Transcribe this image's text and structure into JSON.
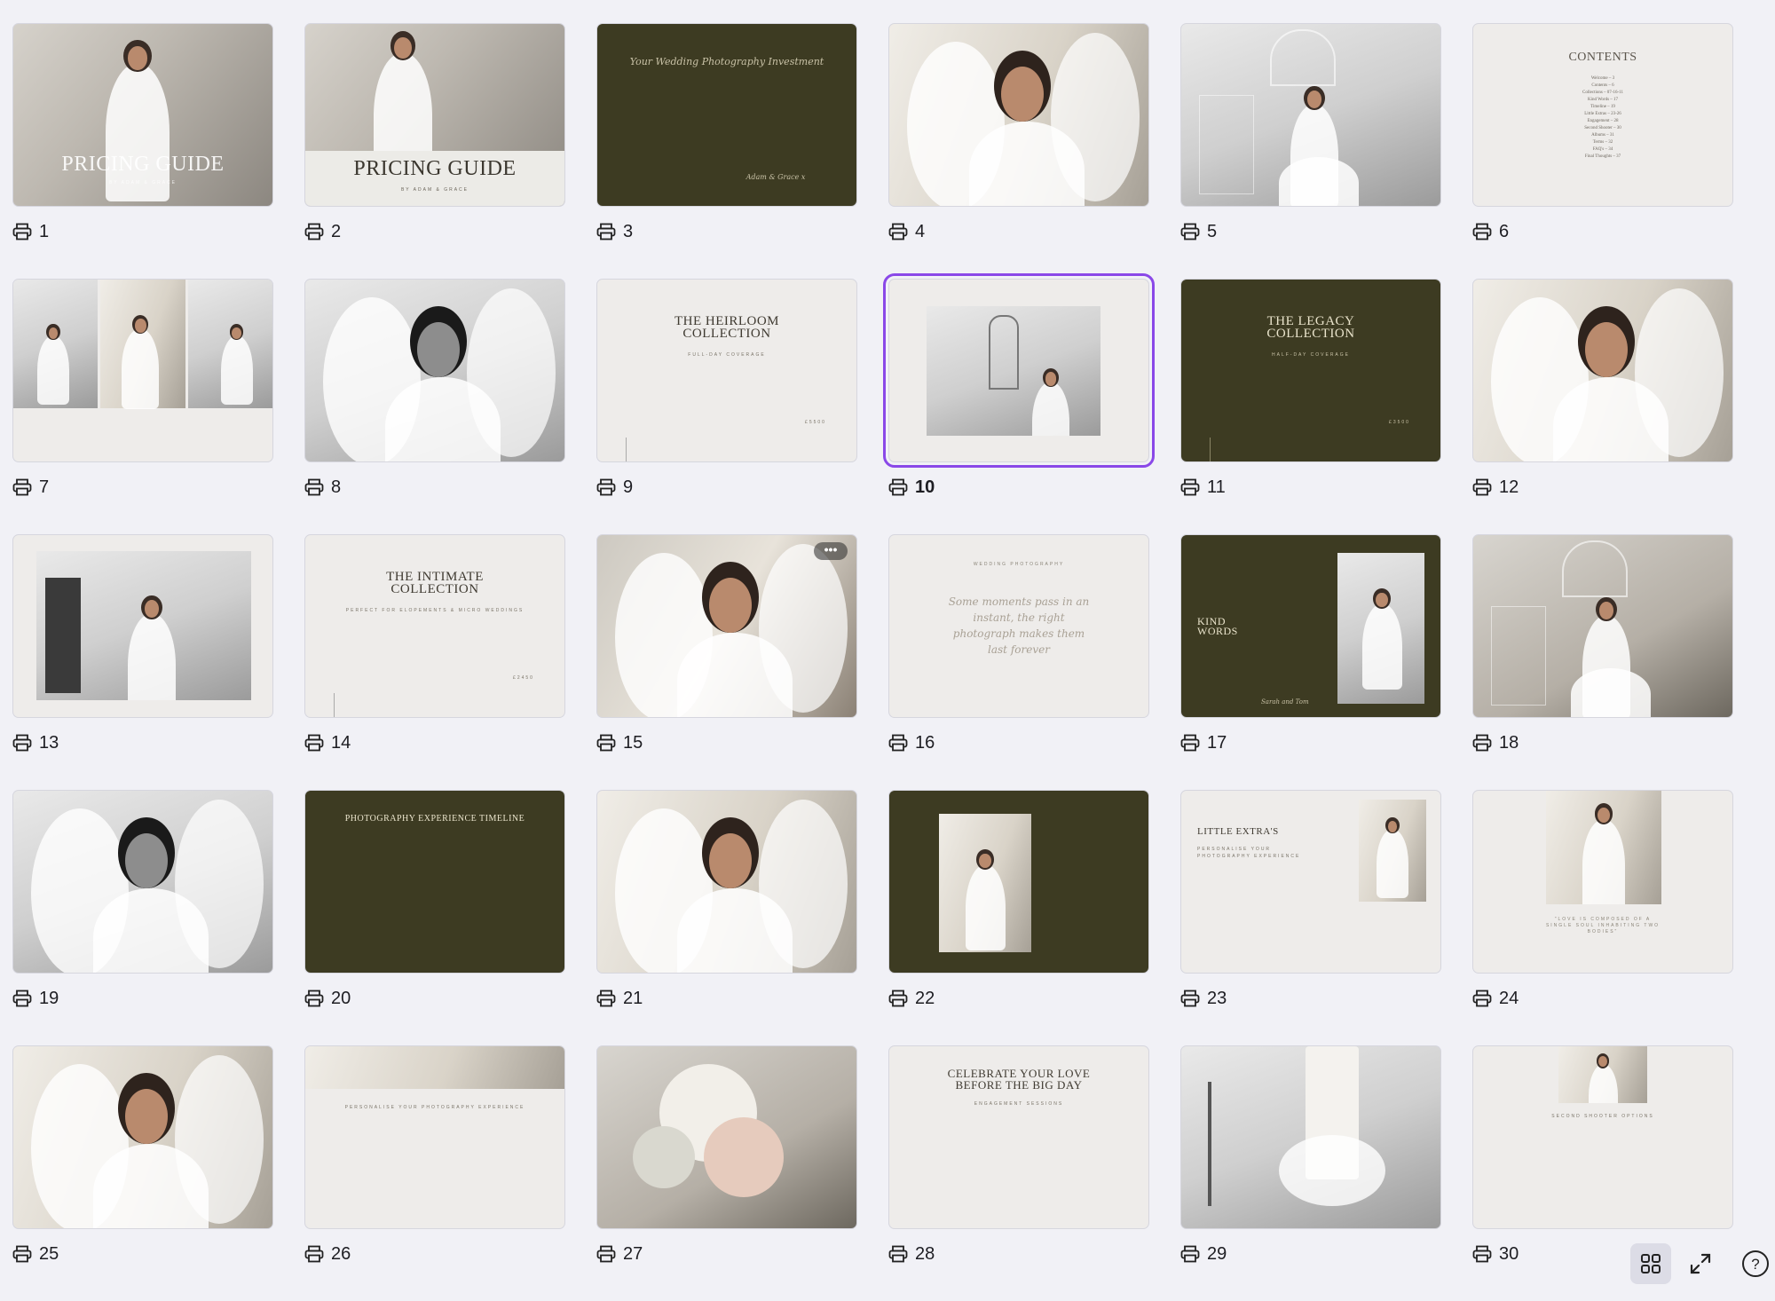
{
  "selected_page": "10",
  "pages": [
    {
      "number": "1",
      "style": "photo-a",
      "title": "PRICING GUIDE",
      "sub": "BY ADAM & GRACE",
      "layout": "cover-photo"
    },
    {
      "number": "2",
      "style": "photo-a",
      "title": "PRICING GUIDE",
      "sub": "BY ADAM & GRACE",
      "layout": "cover-split"
    },
    {
      "number": "3",
      "style": "dark",
      "script": "Your Wedding Photography Investment",
      "sign": "Adam & Grace x",
      "layout": "text-two-col"
    },
    {
      "number": "4",
      "style": "photo-c",
      "layout": "portrait"
    },
    {
      "number": "5",
      "style": "photo-b",
      "layout": "full-figure"
    },
    {
      "number": "6",
      "style": "light",
      "title": "CONTENTS",
      "toc": "Welcome – 3\nContents – 6\nCollections – 07-16-11\nKind Words – 17\nTimeline – 19\nLittle Extras – 23-26\nEngagement – 28\nSecond Shooter – 30\nAlbums – 31\nTerms – 32\nFAQ's – 34\nFinal Thoughts – 37",
      "layout": "toc"
    },
    {
      "number": "7",
      "style": "light",
      "layout": "triptych"
    },
    {
      "number": "8",
      "style": "photo-b",
      "layout": "portrait-bw"
    },
    {
      "number": "9",
      "style": "light",
      "title": "THE HEIRLOOM\nCOLLECTION",
      "sub": "FULL-DAY COVERAGE",
      "price": "£5500",
      "layout": "collection"
    },
    {
      "number": "10",
      "style": "light",
      "layout": "inset-photo"
    },
    {
      "number": "11",
      "style": "dark",
      "title": "THE LEGACY\nCOLLECTION",
      "sub": "HALF-DAY COVERAGE",
      "price": "£3500",
      "layout": "collection"
    },
    {
      "number": "12",
      "style": "photo-c",
      "layout": "portrait"
    },
    {
      "number": "13",
      "style": "light",
      "layout": "inset-wide"
    },
    {
      "number": "14",
      "style": "light",
      "title": "THE INTIMATE\nCOLLECTION",
      "sub": "PERFECT FOR ELOPEMENTS & MICRO WEDDINGS",
      "price": "£2450",
      "layout": "collection"
    },
    {
      "number": "15",
      "style": "photo-e",
      "layout": "portrait",
      "more": "•••"
    },
    {
      "number": "16",
      "style": "light",
      "sub": "WEDDING PHOTOGRAPHY",
      "script": "Some moments pass in an instant, the right photograph makes them last forever",
      "layout": "quote"
    },
    {
      "number": "17",
      "style": "dark",
      "title": "KIND\nWORDS",
      "sign": "Sarah and Tom",
      "layout": "kind-words"
    },
    {
      "number": "18",
      "style": "photo-d",
      "layout": "full-figure"
    },
    {
      "number": "19",
      "style": "photo-b",
      "layout": "portrait-bw"
    },
    {
      "number": "20",
      "style": "dark",
      "title": "PHOTOGRAPHY EXPERIENCE TIMELINE",
      "layout": "timeline"
    },
    {
      "number": "21",
      "style": "photo-c",
      "layout": "portrait"
    },
    {
      "number": "22",
      "style": "dark",
      "layout": "dark-inset"
    },
    {
      "number": "23",
      "style": "light",
      "title": "LITTLE EXTRA'S",
      "sub": "PERSONALISE YOUR PHOTOGRAPHY EXPERIENCE",
      "layout": "extras"
    },
    {
      "number": "24",
      "style": "light",
      "sub": "\"LOVE IS COMPOSED OF A SINGLE SOUL INHABITING TWO BODIES\"",
      "layout": "quote-photo"
    },
    {
      "number": "25",
      "style": "photo-c",
      "layout": "portrait"
    },
    {
      "number": "26",
      "style": "light",
      "sub": "PERSONALISE YOUR PHOTOGRAPHY EXPERIENCE",
      "layout": "price-list"
    },
    {
      "number": "27",
      "style": "photo-d",
      "layout": "bouquet"
    },
    {
      "number": "28",
      "style": "light",
      "title": "CELEBRATE YOUR LOVE\nBEFORE THE BIG DAY",
      "sub": "ENGAGEMENT SESSIONS",
      "layout": "engagement"
    },
    {
      "number": "29",
      "style": "photo-b",
      "layout": "cake"
    },
    {
      "number": "30",
      "style": "light",
      "sub": "SECOND SHOOTER OPTIONS",
      "layout": "second-shooter"
    }
  ],
  "controls": {
    "grid_view_icon": "grid-view-icon",
    "fullscreen_icon": "fullscreen-icon",
    "help_label": "?"
  }
}
